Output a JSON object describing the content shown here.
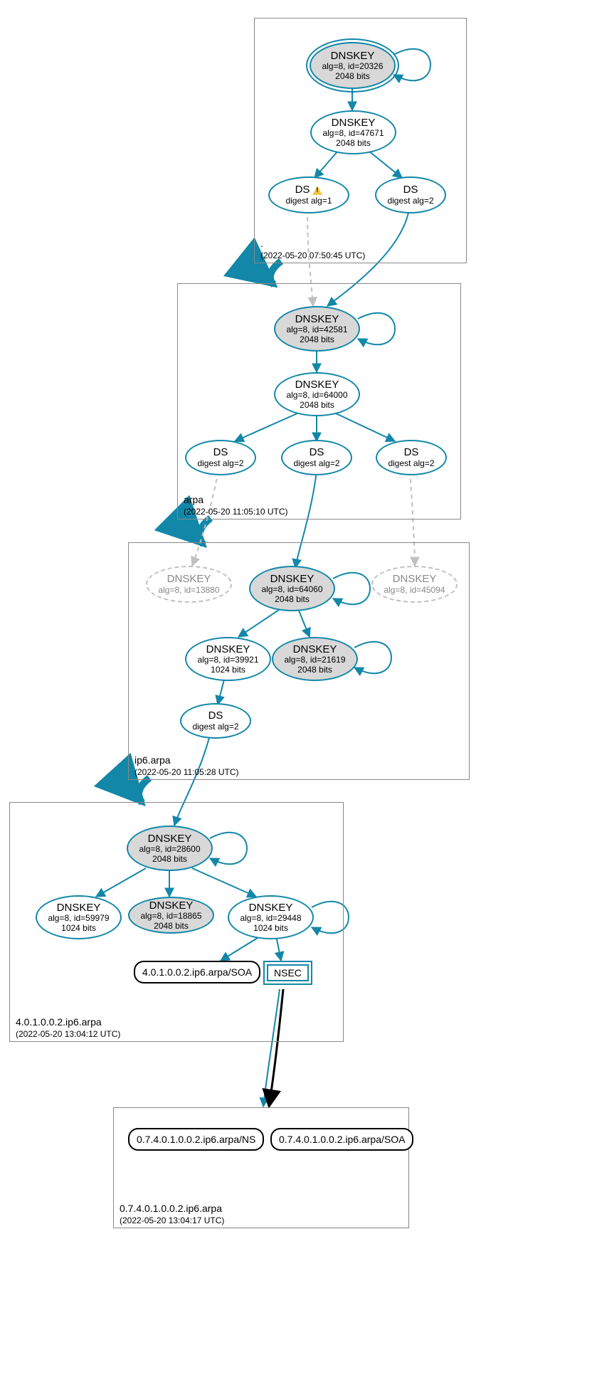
{
  "zones": {
    "root": {
      "name": ".",
      "timestamp": "(2022-05-20 07:50:45 UTC)"
    },
    "arpa": {
      "name": "arpa",
      "timestamp": "(2022-05-20 11:05:10 UTC)"
    },
    "ip6": {
      "name": "ip6.arpa",
      "timestamp": "(2022-05-20 11:05:28 UTC)"
    },
    "z4": {
      "name": "4.0.1.0.0.2.ip6.arpa",
      "timestamp": "(2022-05-20 13:04:12 UTC)"
    },
    "z07": {
      "name": "0.7.4.0.1.0.0.2.ip6.arpa",
      "timestamp": "(2022-05-20 13:04:17 UTC)"
    }
  },
  "nodes": {
    "root_ksk": {
      "title": "DNSKEY",
      "line2": "alg=8, id=20326",
      "line3": "2048 bits"
    },
    "root_zsk": {
      "title": "DNSKEY",
      "line2": "alg=8, id=47671",
      "line3": "2048 bits"
    },
    "root_ds1": {
      "title": "DS",
      "line2": "digest alg=1",
      "warning": true
    },
    "root_ds2": {
      "title": "DS",
      "line2": "digest alg=2"
    },
    "arpa_ksk": {
      "title": "DNSKEY",
      "line2": "alg=8, id=42581",
      "line3": "2048 bits"
    },
    "arpa_zsk": {
      "title": "DNSKEY",
      "line2": "alg=8, id=64000",
      "line3": "2048 bits"
    },
    "arpa_ds_a": {
      "title": "DS",
      "line2": "digest alg=2"
    },
    "arpa_ds_b": {
      "title": "DS",
      "line2": "digest alg=2"
    },
    "arpa_ds_c": {
      "title": "DS",
      "line2": "digest alg=2"
    },
    "ip6_dnskey_13880": {
      "title": "DNSKEY",
      "line2": "alg=8, id=13880"
    },
    "ip6_dnskey_64060": {
      "title": "DNSKEY",
      "line2": "alg=8, id=64060",
      "line3": "2048 bits"
    },
    "ip6_dnskey_45094": {
      "title": "DNSKEY",
      "line2": "alg=8, id=45094"
    },
    "ip6_dnskey_39921": {
      "title": "DNSKEY",
      "line2": "alg=8, id=39921",
      "line3": "1024 bits"
    },
    "ip6_dnskey_21619": {
      "title": "DNSKEY",
      "line2": "alg=8, id=21619",
      "line3": "2048 bits"
    },
    "ip6_ds": {
      "title": "DS",
      "line2": "digest alg=2"
    },
    "z4_dnskey_28600": {
      "title": "DNSKEY",
      "line2": "alg=8, id=28600",
      "line3": "2048 bits"
    },
    "z4_dnskey_59979": {
      "title": "DNSKEY",
      "line2": "alg=8, id=59979",
      "line3": "1024 bits"
    },
    "z4_dnskey_18865": {
      "title": "DNSKEY",
      "line2": "alg=8, id=18865",
      "line3": "2048 bits"
    },
    "z4_dnskey_29448": {
      "title": "DNSKEY",
      "line2": "alg=8, id=29448",
      "line3": "1024 bits"
    },
    "z4_soa": {
      "label": "4.0.1.0.0.2.ip6.arpa/SOA"
    },
    "z4_nsec": {
      "label": "NSEC"
    },
    "z07_ns": {
      "label": "0.7.4.0.1.0.0.2.ip6.arpa/NS"
    },
    "z07_soa": {
      "label": "0.7.4.0.1.0.0.2.ip6.arpa/SOA"
    }
  }
}
